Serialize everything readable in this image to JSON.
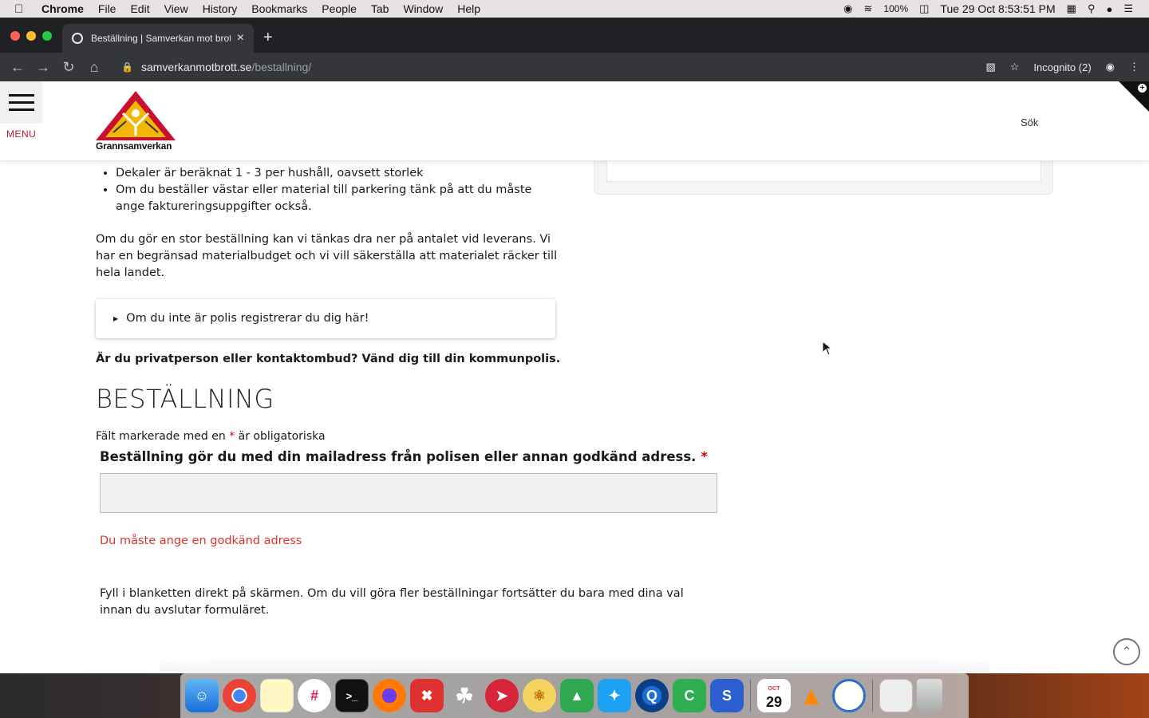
{
  "menubar": {
    "app": "Chrome",
    "items": [
      "File",
      "Edit",
      "View",
      "History",
      "Bookmarks",
      "People",
      "Tab",
      "Window",
      "Help"
    ],
    "battery": "100%",
    "datetime": "Tue 29 Oct  8:53:51 PM"
  },
  "browser": {
    "tab_title": "Beställning | Samverkan mot brott",
    "url_host": "samverkanmotbrott.se",
    "url_path": "/bestallning/",
    "incognito_label": "Incognito (2)"
  },
  "site": {
    "menu_label": "MENU",
    "logo_text": "Grannsamverkan",
    "search_label": "Sök"
  },
  "content": {
    "bullets": [
      "Dekaler är beräknat 1 - 3 per hushåll, oavsett storlek",
      "Om du beställer västar eller material till parkering tänk på att du måste ange faktureringsuppgifter också."
    ],
    "para1": "Om du gör en stor beställning kan vi tänkas dra ner på antalet vid leverans. Vi har en begränsad materialbudget och vi vill säkerställa att materialet räcker till hela landet.",
    "disclosure": "Om du inte är polis registrerar du dig här!",
    "bold_line": "Är du privatperson eller kontaktombud? Vänd dig till din kommunpolis.",
    "section_title": "BESTÄLLNING",
    "req_note_pre": "Fält markerade med en",
    "req_star": "*",
    "req_note_post": "är obligatoriska",
    "field_label": "Beställning gör du med din mailadress från polisen eller annan godkänd adress.",
    "field_value": "",
    "error": "Du måste ange en godkänd adress",
    "para2": "Fyll i blanketten direkt på skärmen. Om du vill göra fler beställningar fortsätter du bara med dina val innan du avslutar formuläret."
  },
  "dock": {
    "calendar_day": "29",
    "calendar_month": "OCT"
  },
  "colors": {
    "accent_red": "#c8102e",
    "error_red": "#d9342b"
  }
}
